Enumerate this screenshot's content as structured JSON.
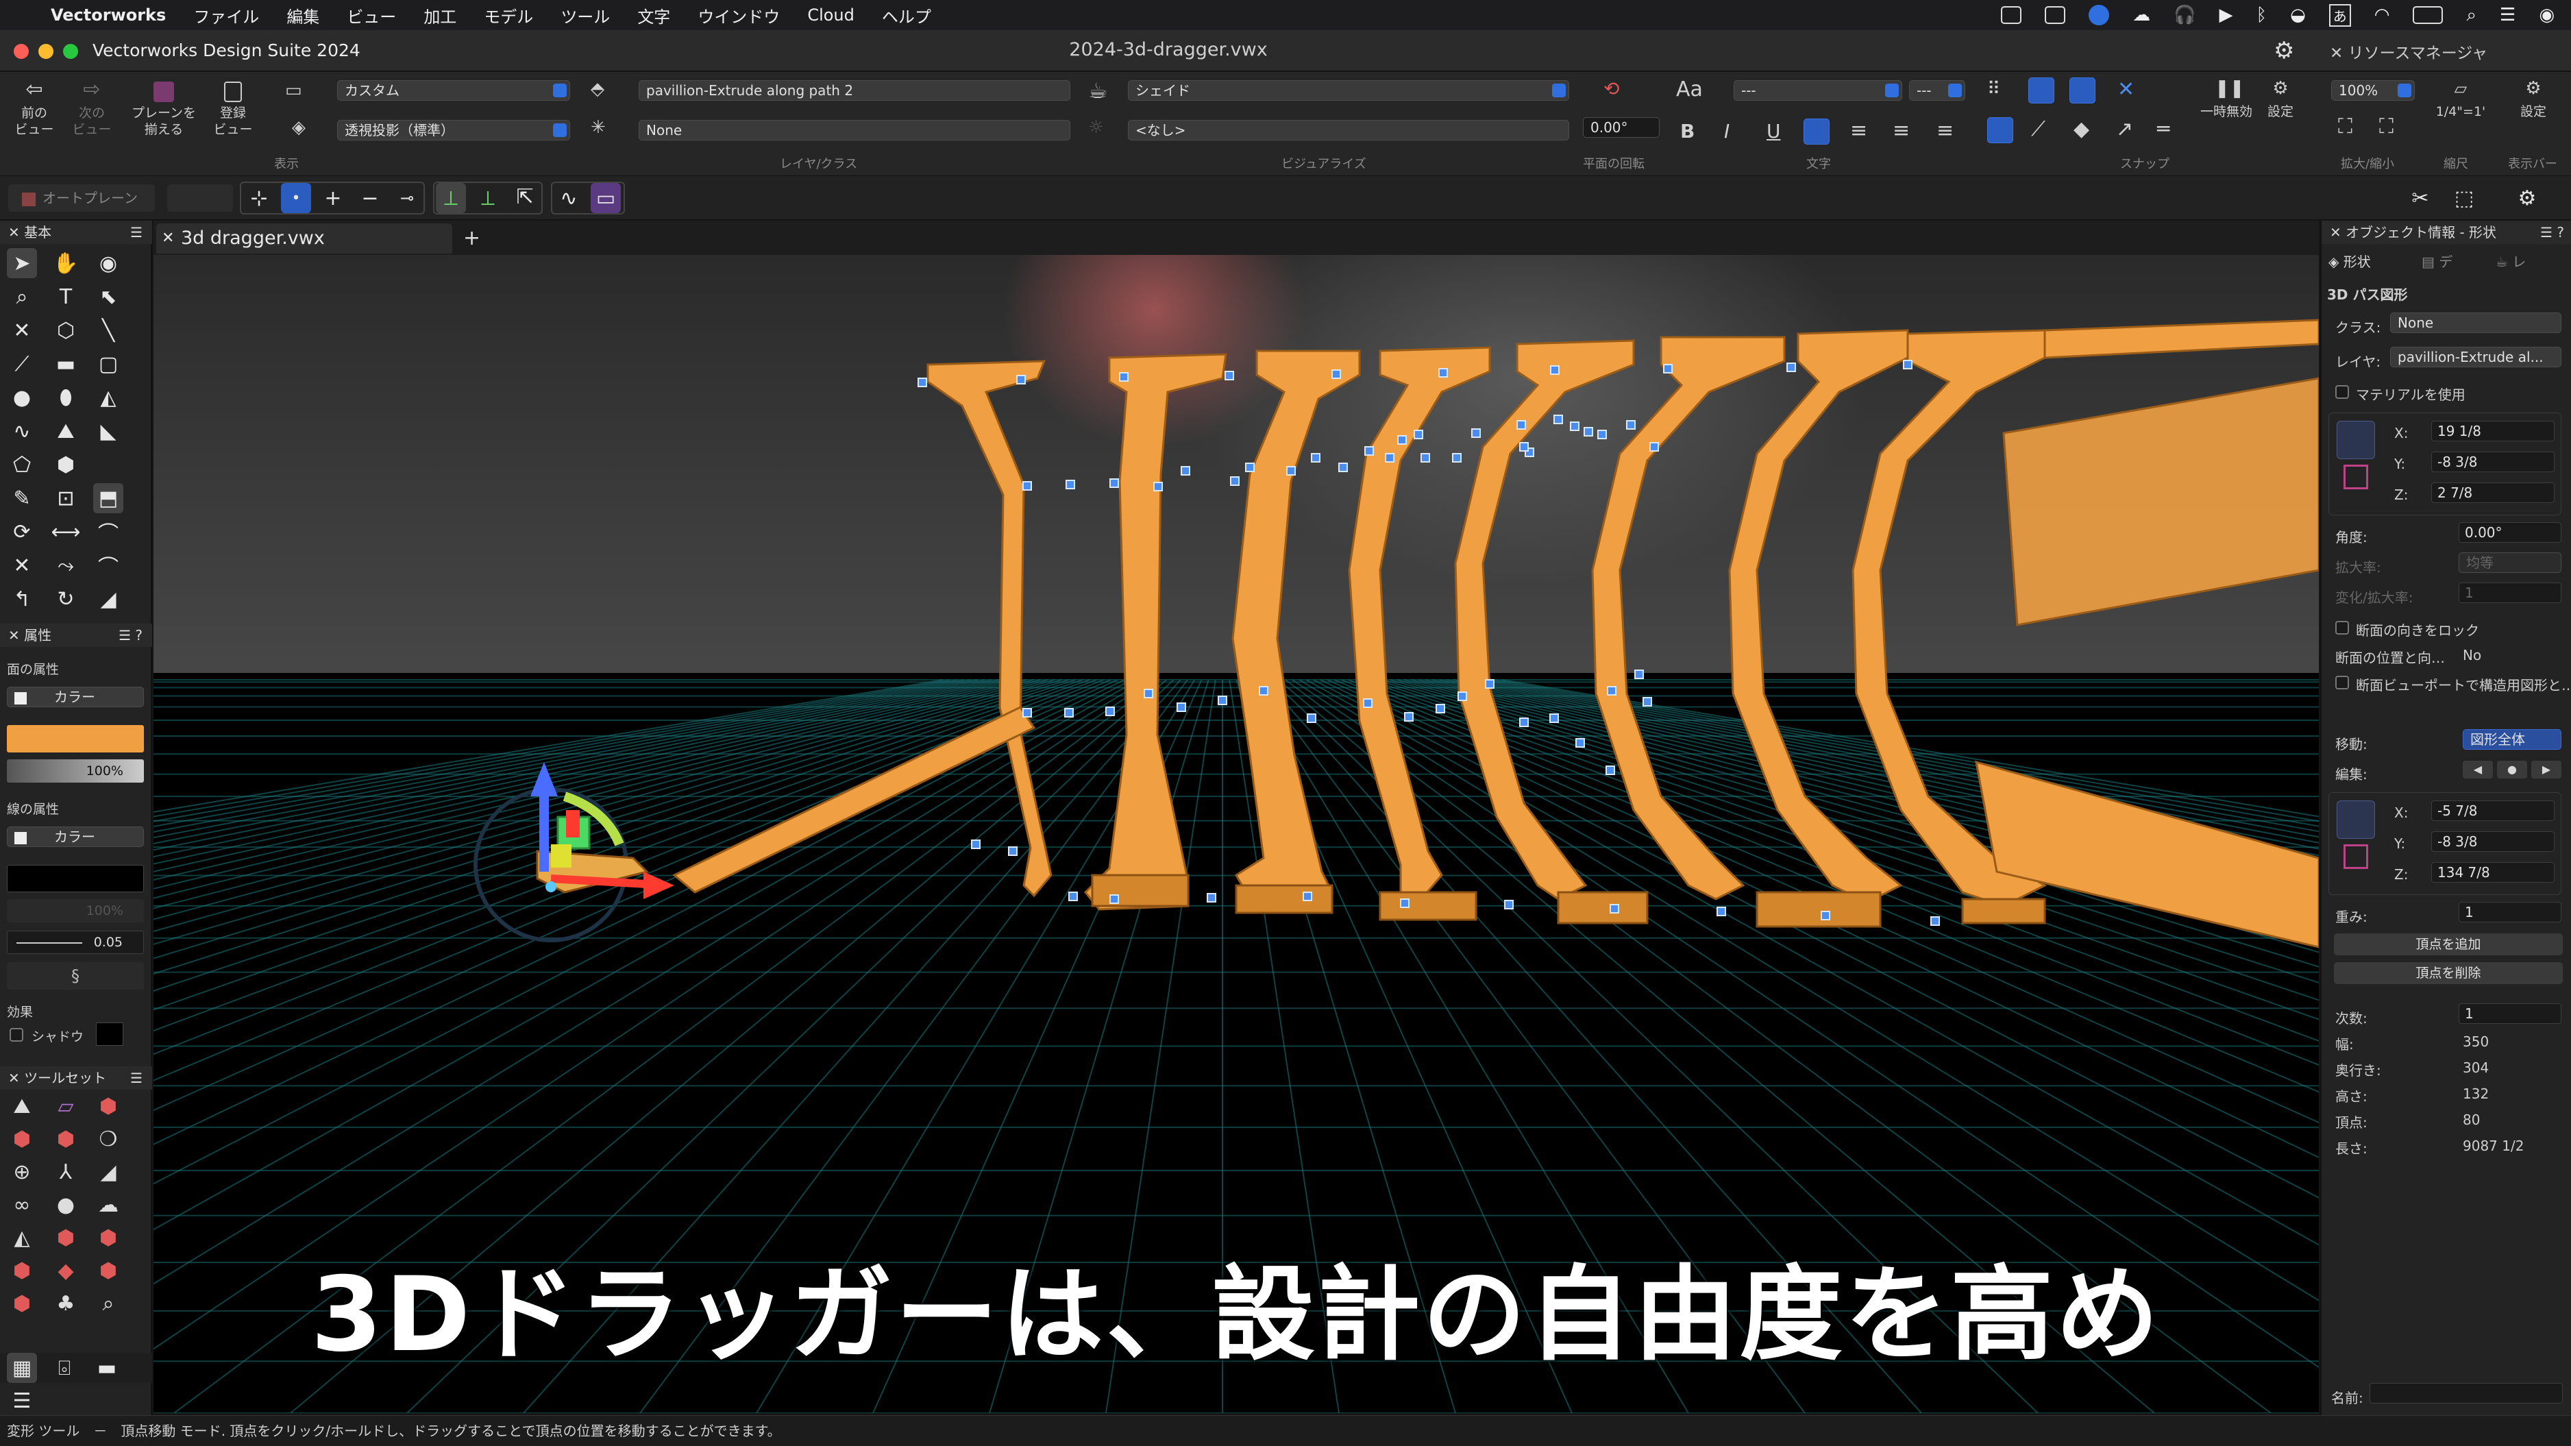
{
  "menubar": {
    "apple": "",
    "app": "Vectorworks",
    "items": [
      "ファイル",
      "編集",
      "ビュー",
      "加工",
      "モデル",
      "ツール",
      "文字",
      "ウインドウ",
      "Cloud",
      "ヘルプ"
    ]
  },
  "window": {
    "app_title": "Vectorworks Design Suite 2024",
    "doc_title": "2024-3d-dragger.vwx",
    "resource_manager": "リソースマネージャ"
  },
  "toolbar": {
    "prev_view": "前の\nビュー",
    "next_view": "次の\nビュー",
    "align_plane": "プレーンを\n揃える",
    "saved_view": "登録\nビュー",
    "view_value": "カスタム",
    "projection_value": "透視投影（標準）",
    "group_view": "表示",
    "layer_value": "pavillion-Extrude along path 2",
    "class_value": "None",
    "group_layer_class": "レイヤ/クラス",
    "render_value": "シェイド",
    "render_sub_value": "<なし>",
    "group_visualize": "ビジュアライズ",
    "rotation_value": "0.00°",
    "group_rotation": "平面の回転",
    "font_label": "Aa",
    "font_value": "---",
    "size_value": "---",
    "bold": "B",
    "italic": "I",
    "underline": "U",
    "group_text": "文字",
    "group_snap": "スナップ",
    "suspend": "一時無効",
    "settings": "設定",
    "zoom_value": "100%",
    "group_zoom": "拡大/縮小",
    "scale_value": "1/4\"=1'",
    "group_scale": "縮尺",
    "settings2": "設定",
    "group_display_bar": "表示バー"
  },
  "modebar": {
    "autoplane": "オートプレーン"
  },
  "left_palette": {
    "basic_title": "基本",
    "attributes_title": "属性",
    "fill_label": "面の属性",
    "fill_type": "カラー",
    "fill_opacity": "100%",
    "line_label": "線の属性",
    "line_type": "カラー",
    "line_opacity": "100%",
    "line_weight": "0.05",
    "effects_label": "効果",
    "shadow_label": "シャドウ",
    "toolset_title": "ツールセット"
  },
  "tabs": {
    "doc_tab": "3d dragger.vwx",
    "add": "+"
  },
  "viewport": {
    "caption": "3Dドラッガーは、設計の自由度を高め",
    "accent_orange": "#f0a043",
    "vertex_blue": "#4b8cf0",
    "grid_teal": "#1b7a7e"
  },
  "obj_info": {
    "title": "オブジェクト情報 - 形状",
    "tab_shape": "形状",
    "tab_data": "デ",
    "tab_render": "レ",
    "object_type": "3D パス図形",
    "class_label": "クラス:",
    "class_value": "None",
    "layer_label": "レイヤ:",
    "layer_value": "pavillion-Extrude al...",
    "use_material": "マテリアルを使用",
    "x_label": "X:",
    "x_value": "19 1/8",
    "y_label": "Y:",
    "y_value": "-8 3/8",
    "z_label": "Z:",
    "z_value": "2 7/8",
    "angle_label": "角度:",
    "angle_value": "0.00°",
    "scale_label": "拡大率:",
    "scale_value": "均等",
    "change_scale_label": "変化/拡大率:",
    "change_scale_value": "1",
    "lock_section": "断面の向きをロック",
    "section_pos_label": "断面の位置と向…",
    "section_pos_value": "No",
    "section_viewport": "断面ビューポートで構造用図形と…",
    "move_label": "移動:",
    "move_value": "図形全体",
    "edit_label": "編集:",
    "x2_label": "X:",
    "x2_value": "-5 7/8",
    "y2_label": "Y:",
    "y2_value": "-8 3/8",
    "z2_label": "Z:",
    "z2_value": "134 7/8",
    "weight_label": "重み:",
    "weight_value": "1",
    "add_vertex": "頂点を追加",
    "delete_vertex": "頂点を削除",
    "degree_label": "次数:",
    "degree_value": "1",
    "width_label": "幅:",
    "width_value": "350",
    "depth_label": "奥行き:",
    "depth_value": "304",
    "height_label": "高さ:",
    "height_value": "132",
    "vertices_label": "頂点:",
    "vertices_value": "80",
    "length_label": "長さ:",
    "length_value": "9087 1/2",
    "name_label": "名前:"
  },
  "status": {
    "text": "変形 ツール　－　頂点移動 モード. 頂点をクリック/ホールドし、ドラッグすることで頂点の位置を移動することができます。"
  }
}
